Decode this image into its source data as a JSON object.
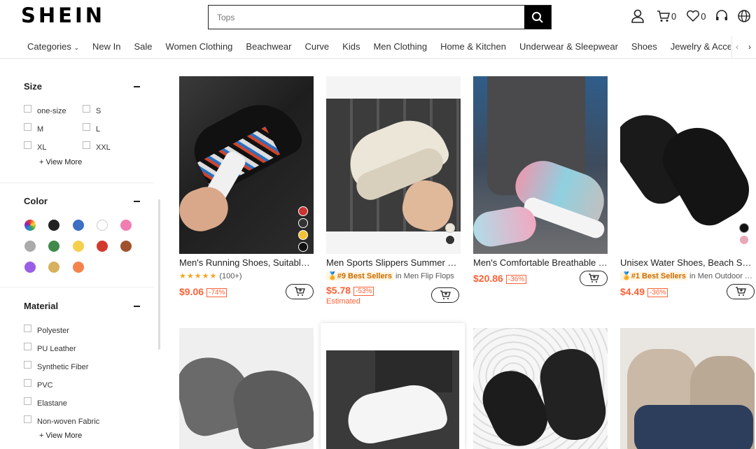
{
  "header": {
    "logo": "SHEIN",
    "search_placeholder": "Tops",
    "cart_count": "0",
    "wishlist_count": "0"
  },
  "nav": {
    "items": [
      "Categories",
      "New In",
      "Sale",
      "Women Clothing",
      "Beachwear",
      "Curve",
      "Kids",
      "Men Clothing",
      "Home & Kitchen",
      "Underwear & Sleepwear",
      "Shoes",
      "Jewelry & Accessories"
    ]
  },
  "filters": {
    "size": {
      "title": "Size",
      "options": [
        "one-size",
        "S",
        "M",
        "L",
        "XL",
        "XXL"
      ],
      "view_more": "View More"
    },
    "color": {
      "title": "Color",
      "swatches": [
        "multi",
        "#222222",
        "#3d6fc4",
        "#ffffff",
        "#f07fb0",
        "#aaaaaa",
        "#3f8a4b",
        "#f5cf4e",
        "#d23a2e",
        "#a0522d",
        "#9b5de5",
        "#d6b25e",
        "#f4844b"
      ]
    },
    "material": {
      "title": "Material",
      "options": [
        "Polyester",
        "PU Leather",
        "Synthetic Fiber",
        "PVC",
        "Elastane",
        "Non-woven Fabric"
      ],
      "view_more": "View More"
    }
  },
  "products": [
    {
      "name": "Men's Running Shoes, Suitable For Outdoor",
      "rating_count": "(100+)",
      "price": "$9.06",
      "discount": "-74%"
    },
    {
      "name": "Men Sports Slippers Summer Open Toe",
      "badge": "#9 Best Sellers",
      "badge_context": "in Men Flip Flops",
      "price": "$5.78",
      "discount": "-53%",
      "note": "Estimated"
    },
    {
      "name": "Men's Comfortable Breathable Sneakers",
      "price": "$20.86",
      "discount": "-36%"
    },
    {
      "name": "Unisex Water Shoes, Beach Swim Socks",
      "badge": "#1 Best Sellers",
      "badge_context": "in Men Outdoor Shoes",
      "price": "$4.49",
      "discount": "-36%"
    }
  ]
}
